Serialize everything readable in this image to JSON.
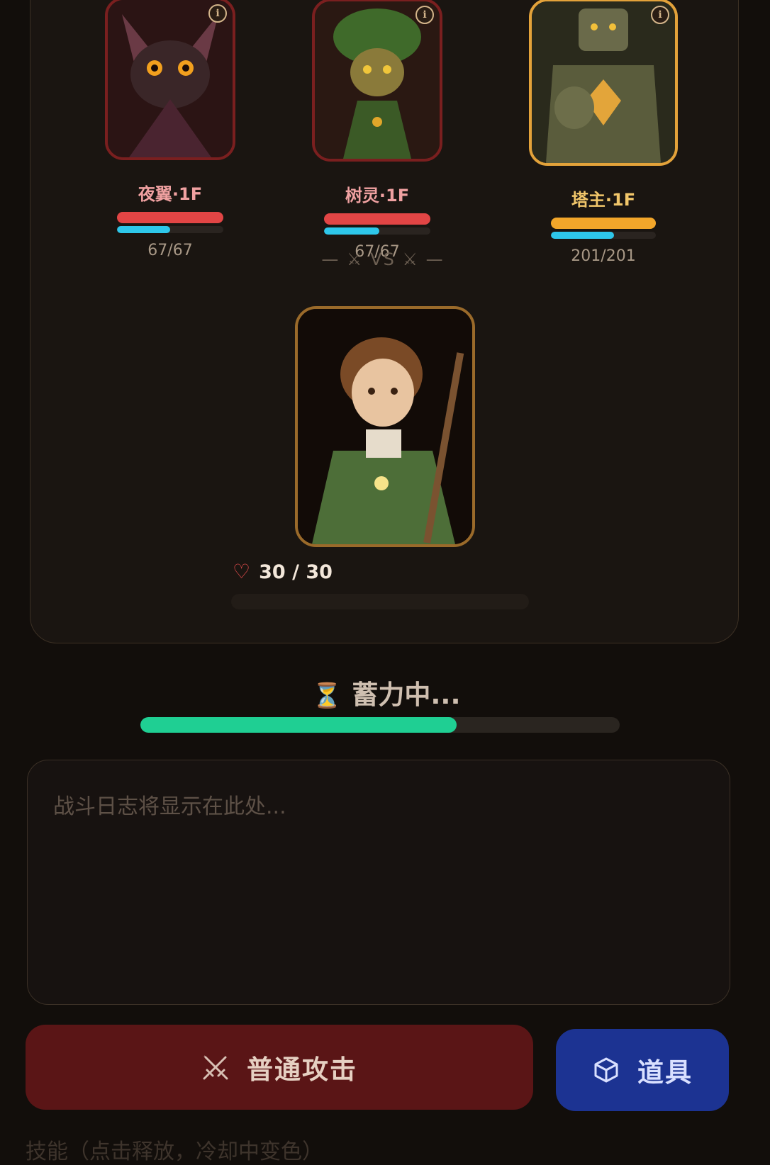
{
  "enemies": [
    {
      "name": "夜翼·1F",
      "hp_text": "67/67",
      "hp_fraction": 1.0,
      "mp_fraction": 0.5,
      "icon": "bat-creature",
      "boss": false
    },
    {
      "name": "树灵·1F",
      "hp_text": "67/67",
      "hp_fraction": 1.0,
      "mp_fraction": 0.52,
      "icon": "tree-spirit",
      "boss": false
    },
    {
      "name": "塔主·1F",
      "hp_text": "201/201",
      "hp_fraction": 1.0,
      "mp_fraction": 0.6,
      "icon": "stone-golem",
      "boss": true
    }
  ],
  "info_symbol": "i",
  "vs_label": "— ⚔ VS ⚔ —",
  "hero": {
    "hp_text": "30 / 30",
    "icon": "young-adventurer-with-staff",
    "heart_symbol": "♡"
  },
  "charge": {
    "label": "蓄力中...",
    "progress": 0.66,
    "icon": "hourglass-icon",
    "symbol": "⏳"
  },
  "log": {
    "placeholder": "战斗日志将显示在此处..."
  },
  "actions": {
    "attack_label": "普通攻击",
    "item_label": "道具"
  },
  "footer": {
    "text": "技能（点击释放，冷却中变色）"
  },
  "colors": {
    "hp_red": "#e24545",
    "boss_gold": "#f2a62a",
    "mana_cyan": "#2ec7ea",
    "charge_green": "#1fcf93",
    "attack_bg": "#5a1516",
    "item_bg": "#1c3392"
  }
}
